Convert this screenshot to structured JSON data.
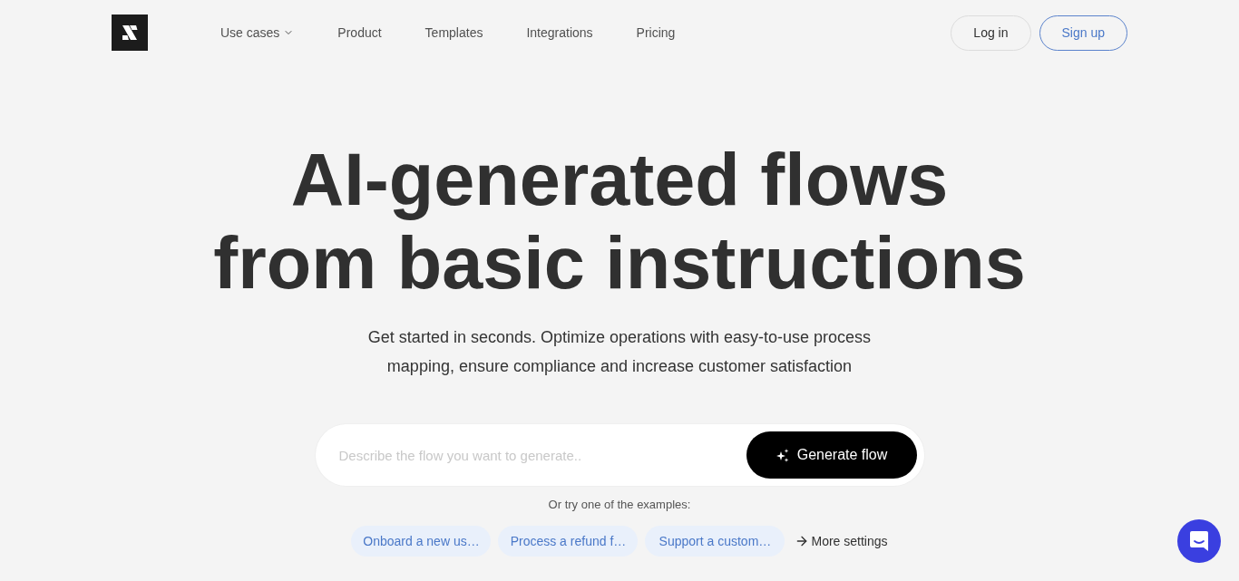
{
  "header": {
    "nav": [
      {
        "label": "Use cases",
        "kind": "dropdown"
      },
      {
        "label": "Product",
        "kind": "link"
      },
      {
        "label": "Templates",
        "kind": "link"
      },
      {
        "label": "Integrations",
        "kind": "link"
      },
      {
        "label": "Pricing",
        "kind": "link"
      }
    ],
    "log_in": "Log in",
    "sign_up": "Sign up"
  },
  "hero": {
    "title": "AI-generated flows from basic instructions",
    "subtitle": "Get started in seconds. Optimize operations with easy-to-use process mapping, ensure compliance and increase customer satisfaction",
    "input": {
      "placeholder": "Describe the flow you want to generate.."
    },
    "generate_button": "Generate flow",
    "examples_label": "Or try one of the examples:",
    "examples": [
      "Onboard a new us…",
      "Process a refund f…",
      "Support a custom…"
    ],
    "more_settings": "More settings"
  }
}
